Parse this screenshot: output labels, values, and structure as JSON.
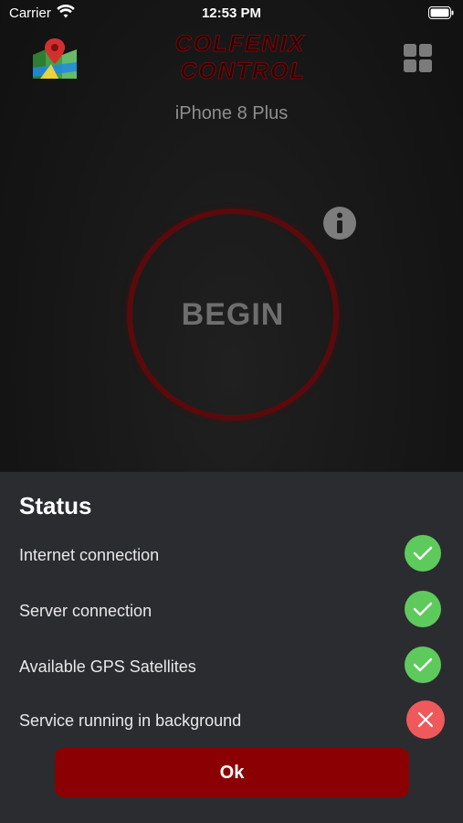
{
  "status_bar": {
    "carrier": "Carrier",
    "time": "12:53 PM",
    "wifi_icon": "wifi-icon",
    "battery_icon": "battery-icon"
  },
  "header": {
    "logo_line1": "COLFENIX",
    "logo_line2": "CONTROL",
    "device_name": "iPhone 8 Plus",
    "map_icon": "map-pin-icon",
    "menu_icon": "grid-icon"
  },
  "main": {
    "begin_label": "BEGIN",
    "info_icon": "info-icon"
  },
  "status_sheet": {
    "title": "Status",
    "items": [
      {
        "label": "Internet connection",
        "status": "ok",
        "icon": "check-icon"
      },
      {
        "label": "Server connection",
        "status": "ok",
        "icon": "check-icon"
      },
      {
        "label": "Available GPS Satellites",
        "status": "ok",
        "icon": "check-icon"
      },
      {
        "label": "Service running in background",
        "status": "error",
        "icon": "close-icon"
      }
    ],
    "ok_label": "Ok"
  },
  "colors": {
    "accent": "#8a0003",
    "success": "#5fca5c",
    "error": "#f0595b",
    "sheet_bg": "#2b2c30"
  }
}
